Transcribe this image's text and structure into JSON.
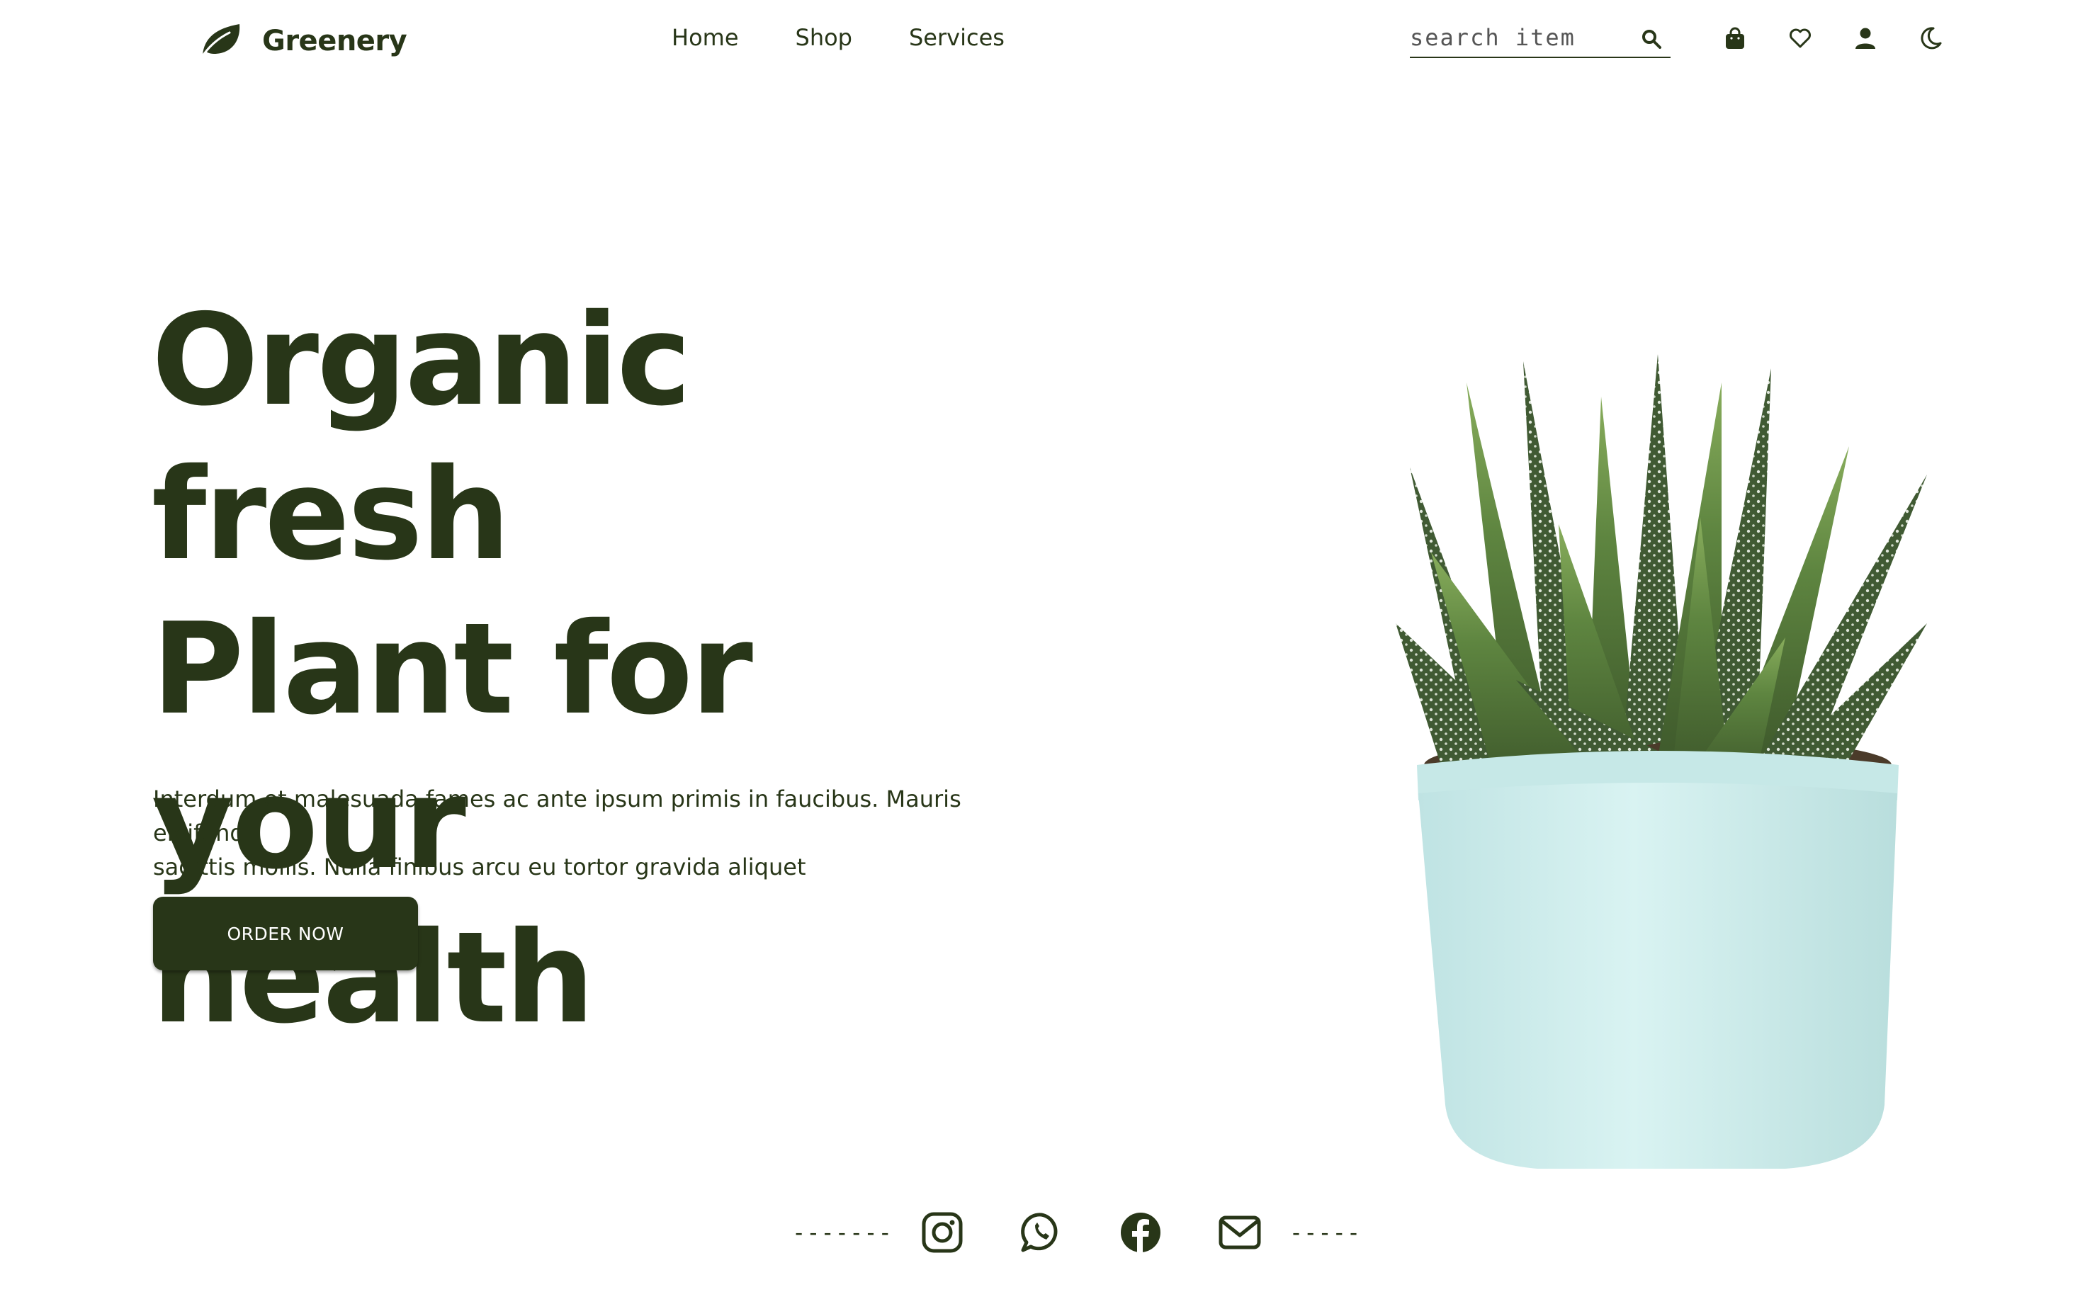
{
  "brand": {
    "name": "Greenery",
    "icon": "leaf-icon"
  },
  "nav": {
    "items": [
      {
        "label": "Home"
      },
      {
        "label": "Shop"
      },
      {
        "label": "Services"
      }
    ]
  },
  "search": {
    "placeholder": "search item",
    "icon": "search-icon"
  },
  "header_icons": [
    "shopping-bag-icon",
    "heart-icon",
    "user-icon",
    "moon-icon"
  ],
  "hero": {
    "title_lines": [
      "Organic fresh",
      "Plant for your",
      "health"
    ],
    "description_lines": [
      "Interdum et malesuada fames ac ante ipsum primis in faucibus. Mauris eleifend",
      "sagittis mollis. Nulla finibus arcu eu tortor gravida aliquet"
    ],
    "cta_label": "ORDER NOW",
    "image": "potted-succulent-plant"
  },
  "social": {
    "left_dashes": "-------",
    "right_dashes": "-----",
    "icons": [
      "instagram-icon",
      "whatsapp-icon",
      "facebook-icon",
      "email-icon"
    ]
  },
  "colors": {
    "primary": "#283618",
    "background": "#ffffff",
    "pot": "#cfeeee",
    "leaf": "#5f8a3a"
  }
}
